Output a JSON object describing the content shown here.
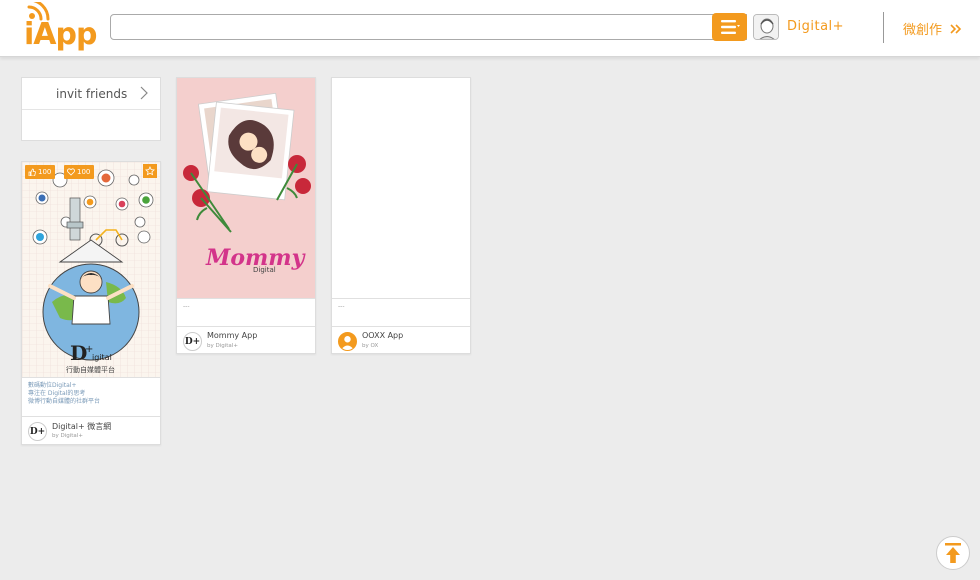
{
  "header": {
    "logo_text": "iApp",
    "search": {
      "value": "",
      "placeholder": ""
    },
    "user_name": "Digital+",
    "create_label": "微創作"
  },
  "invite": {
    "label": "invit friends"
  },
  "cards": [
    {
      "likes": "100",
      "hearts": "100",
      "desc_lines": [
        "數碼動位Digital+",
        "專注在 Digital的思考",
        "微博行動自媒體的社群平台"
      ],
      "name": "Digital+ 微言網",
      "by": "by  Digital+",
      "logo_text": "D+",
      "poster_title": "Digital",
      "poster_subtitle": "行動自媒體平台"
    },
    {
      "desc": "---",
      "name": "Mommy App",
      "by": "by  Digital+",
      "poster_title": "Mommy",
      "poster_sub": "Digital"
    },
    {
      "desc": "---",
      "name": "OOXX App",
      "by": "by  OX"
    }
  ],
  "colors": {
    "accent": "#f39a1e",
    "background": "#ececec"
  }
}
